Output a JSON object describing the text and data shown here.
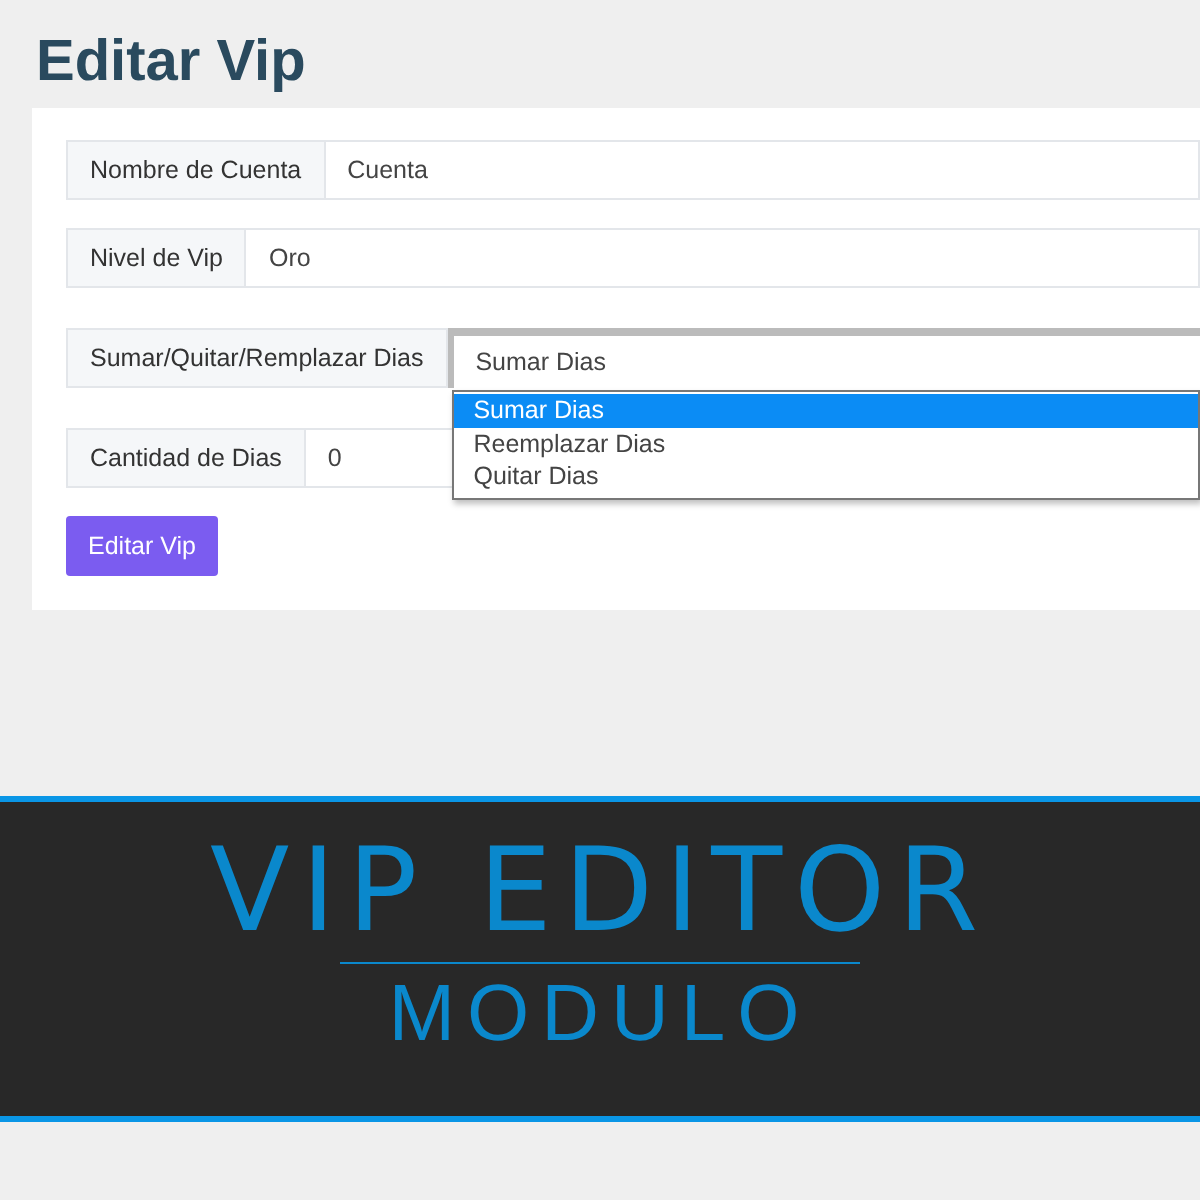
{
  "page_title": "Editar Vip",
  "fields": [
    {
      "kind": "text",
      "label": "Nombre de Cuenta",
      "value": "Cuenta"
    },
    {
      "kind": "text",
      "label": "Nivel de Vip",
      "value": "Oro"
    },
    {
      "kind": "select",
      "label": "Sumar/Quitar/Remplazar Dias",
      "value": "Sumar Dias",
      "expanded": true,
      "options": [
        {
          "label": "Sumar Dias",
          "selected": true
        },
        {
          "label": "Reemplazar Dias",
          "selected": false
        },
        {
          "label": "Quitar Dias",
          "selected": false
        }
      ]
    },
    {
      "kind": "text",
      "label": "Cantidad de Dias",
      "value": "0"
    }
  ],
  "button": "Editar Vip",
  "banner": {
    "title": "VIP EDITOR",
    "subtitle": "MODULO"
  }
}
